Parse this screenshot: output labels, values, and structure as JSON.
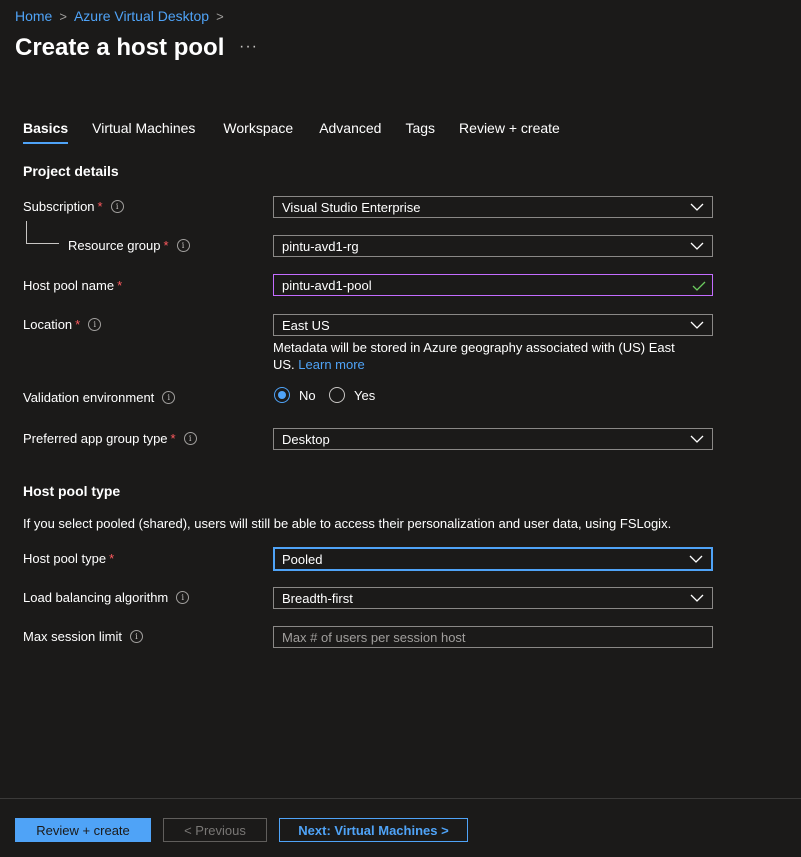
{
  "breadcrumb": {
    "home": "Home",
    "parent": "Azure Virtual Desktop",
    "sep": ">"
  },
  "page": {
    "title": "Create a host pool",
    "more": "···"
  },
  "tabs": [
    "Basics",
    "Virtual Machines",
    "Workspace",
    "Advanced",
    "Tags",
    "Review + create"
  ],
  "project": {
    "heading": "Project details",
    "subscription": {
      "label": "Subscription",
      "value": "Visual Studio Enterprise"
    },
    "resource_group": {
      "label": "Resource group",
      "value": "pintu-avd1-rg"
    },
    "host_pool_name": {
      "label": "Host pool name",
      "value": "pintu-avd1-pool"
    },
    "location": {
      "label": "Location",
      "value": "East US",
      "note": "Metadata will be stored in Azure geography associated with (US) East US.",
      "note_link": "Learn more"
    },
    "validation": {
      "label": "Validation environment",
      "no": "No",
      "yes": "Yes",
      "selected": "No"
    },
    "app_group": {
      "label": "Preferred app group type",
      "value": "Desktop"
    }
  },
  "pool_type": {
    "heading": "Host pool type",
    "description": "If you select pooled (shared), users will still be able to access their personalization and user data, using FSLogix.",
    "type": {
      "label": "Host pool type",
      "value": "Pooled"
    },
    "load_balancing": {
      "label": "Load balancing algorithm",
      "value": "Breadth-first"
    },
    "max_session": {
      "label": "Max session limit",
      "placeholder": "Max # of users per session host"
    }
  },
  "required_mark": "*",
  "info_glyph": "i",
  "footer": {
    "review_label": "Review + create",
    "previous_label": "< Previous",
    "next_label": "Next: Virtual Machines >"
  },
  "colors": {
    "accent": "#4fa3f7",
    "required": "#ff5a5f",
    "background": "#1b1a19"
  }
}
